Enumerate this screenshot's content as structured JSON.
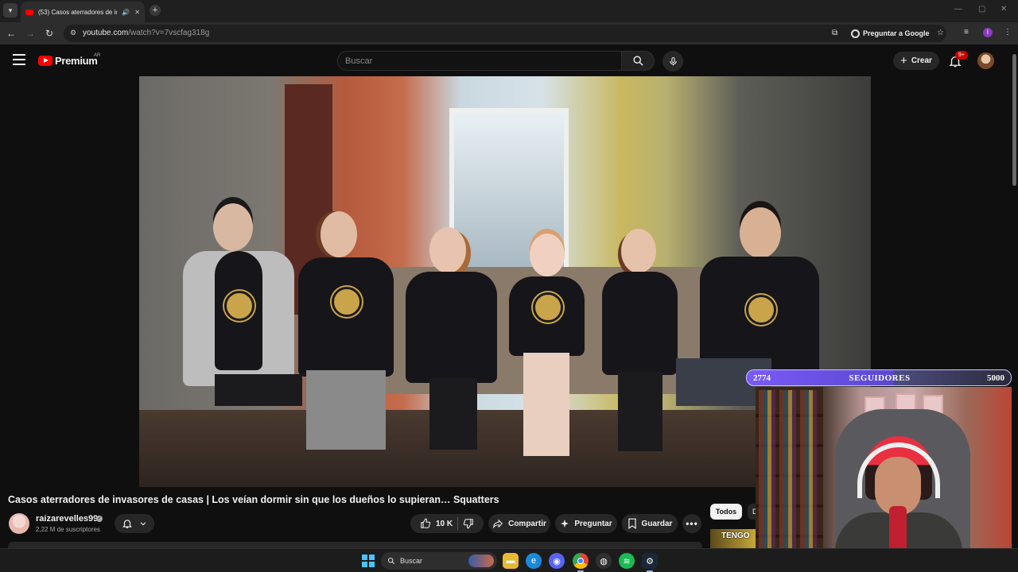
{
  "browser": {
    "tab_title": "(53) Casos aterradores de invasores de casas",
    "tab_audio_icon": "speaker-icon",
    "new_tab_label": "+",
    "url_domain": "youtube.com",
    "url_path": "/watch?v=7vscfag318g",
    "ask_google_label": "Preguntar a Google",
    "profile_initial": "I"
  },
  "header": {
    "logo_text": "Premium",
    "country_code": "AR",
    "search_placeholder": "Buscar",
    "create_label": "Crear",
    "notification_count": "9+"
  },
  "video": {
    "title": "Casos aterradores de invasores de casas | Los veían dormir sin que los dueños lo supieran… Squatters",
    "channel_name": "raizarevelles99",
    "subscribers": "2,22 M de suscriptores",
    "like_count": "10 K",
    "share_label": "Compartir",
    "ask_label": "Preguntar",
    "save_label": "Guardar"
  },
  "sidebar": {
    "filter_all": "Todos",
    "next_chip": "D",
    "thumb_text": "TENGO"
  },
  "overlay": {
    "followers_current": "2774",
    "followers_label": "SEGUIDORES",
    "followers_goal": "5000",
    "progress_fraction": 0.5548
  },
  "taskbar": {
    "search_label": "Buscar",
    "apps": [
      "file-explorer-icon",
      "edge-icon",
      "discord-icon",
      "chrome-icon",
      "obs-icon",
      "spotify-icon",
      "steam-icon"
    ]
  },
  "colors": {
    "youtube_red": "#ff0000",
    "background": "#0f0f0f",
    "overlay_purple": "#6a50d8"
  }
}
